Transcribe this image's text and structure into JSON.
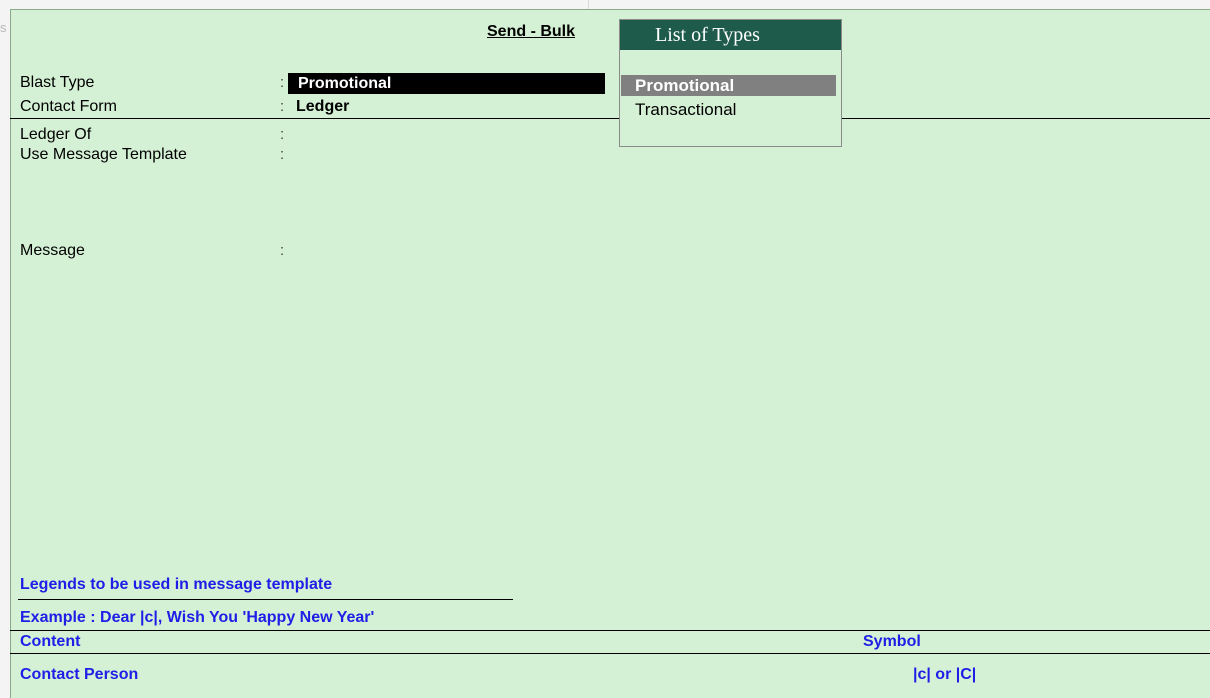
{
  "background_hint": "s",
  "form": {
    "title": "Send - Bulk",
    "fields": [
      {
        "label": "Blast Type",
        "value": "Promotional"
      },
      {
        "label": "Contact Form",
        "value": "Ledger"
      },
      {
        "label": "Ledger Of",
        "value": ""
      },
      {
        "label": "Use Message Template",
        "value": ""
      },
      {
        "label": "Message",
        "value": ""
      }
    ],
    "colon": ":"
  },
  "legends": {
    "heading": "Legends to be used in message template",
    "example": "Example : Dear |c|, Wish You 'Happy New Year'",
    "col_content": "Content",
    "col_symbol": "Symbol",
    "rows": [
      {
        "content": "Contact Person",
        "symbol": "|c| or |C|"
      }
    ]
  },
  "popup": {
    "title": "List of Types",
    "items": [
      "Promotional",
      "Transactional"
    ],
    "selected": "Promotional"
  },
  "colors": {
    "panel_bg": "#d5f1d5",
    "popup_header": "#1e5b4a",
    "legend_text": "#1e1ee6",
    "selected_item": "#808080"
  }
}
